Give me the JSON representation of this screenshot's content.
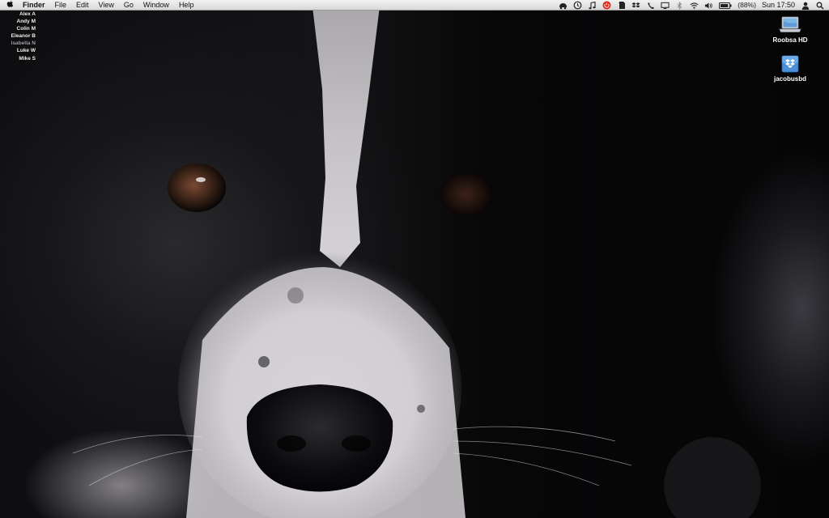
{
  "menubar": {
    "apple_icon": "apple-icon",
    "app_name": "Finder",
    "menus": [
      "File",
      "Edit",
      "View",
      "Go",
      "Window",
      "Help"
    ],
    "status_icons": [
      "growl-icon",
      "timemachine-icon",
      "music-note-icon",
      "power-icon",
      "evernote-icon",
      "dropbox-icon",
      "phone-icon",
      "display-icon",
      "bluetooth-icon",
      "wifi-icon",
      "volume-icon",
      "battery-icon"
    ],
    "battery_text": "(88%)",
    "clock": "Sun 17:50",
    "user_icon": "user-icon",
    "spotlight_icon": "search-icon",
    "accent_colors": {
      "power": "#d9261c",
      "menubar_bg": "#e6e6e6"
    }
  },
  "user_list": [
    {
      "name": "Alex A",
      "dim": false
    },
    {
      "name": "Andy M",
      "dim": false
    },
    {
      "name": "Colin M",
      "dim": false
    },
    {
      "name": "Eleanor B",
      "dim": false
    },
    {
      "name": "Isabella N",
      "dim": true
    },
    {
      "name": "Luke W",
      "dim": false
    },
    {
      "name": "Mike S",
      "dim": false
    }
  ],
  "desktop_icons": [
    {
      "label": "Roobsa HD",
      "icon": "laptop-drive-icon"
    },
    {
      "label": "jacobusbd",
      "icon": "dropbox-folder-icon"
    }
  ],
  "wallpaper": "border-collie-closeup"
}
